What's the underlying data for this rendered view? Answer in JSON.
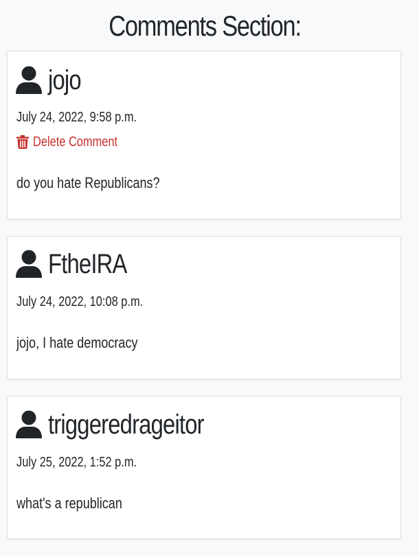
{
  "section": {
    "title": "Comments Section:"
  },
  "comments": [
    {
      "author": "jojo",
      "timestamp": "July 24, 2022, 9:58 p.m.",
      "delete_label": "Delete Comment",
      "body": "do you hate Republicans?"
    },
    {
      "author": "FtheIRA",
      "timestamp": "July 24, 2022, 10:08 p.m.",
      "body": "jojo, I hate democracy"
    },
    {
      "author": "triggeredrageitor",
      "timestamp": "July 25, 2022, 1:52 p.m.",
      "body": "what's a republican"
    }
  ],
  "colors": {
    "text": "#212529",
    "delete": "#c9302c",
    "card_border": "#dee2e6",
    "page_background": "#f8f9fa"
  },
  "icons": {
    "author": "user-icon",
    "delete": "trash-icon"
  }
}
